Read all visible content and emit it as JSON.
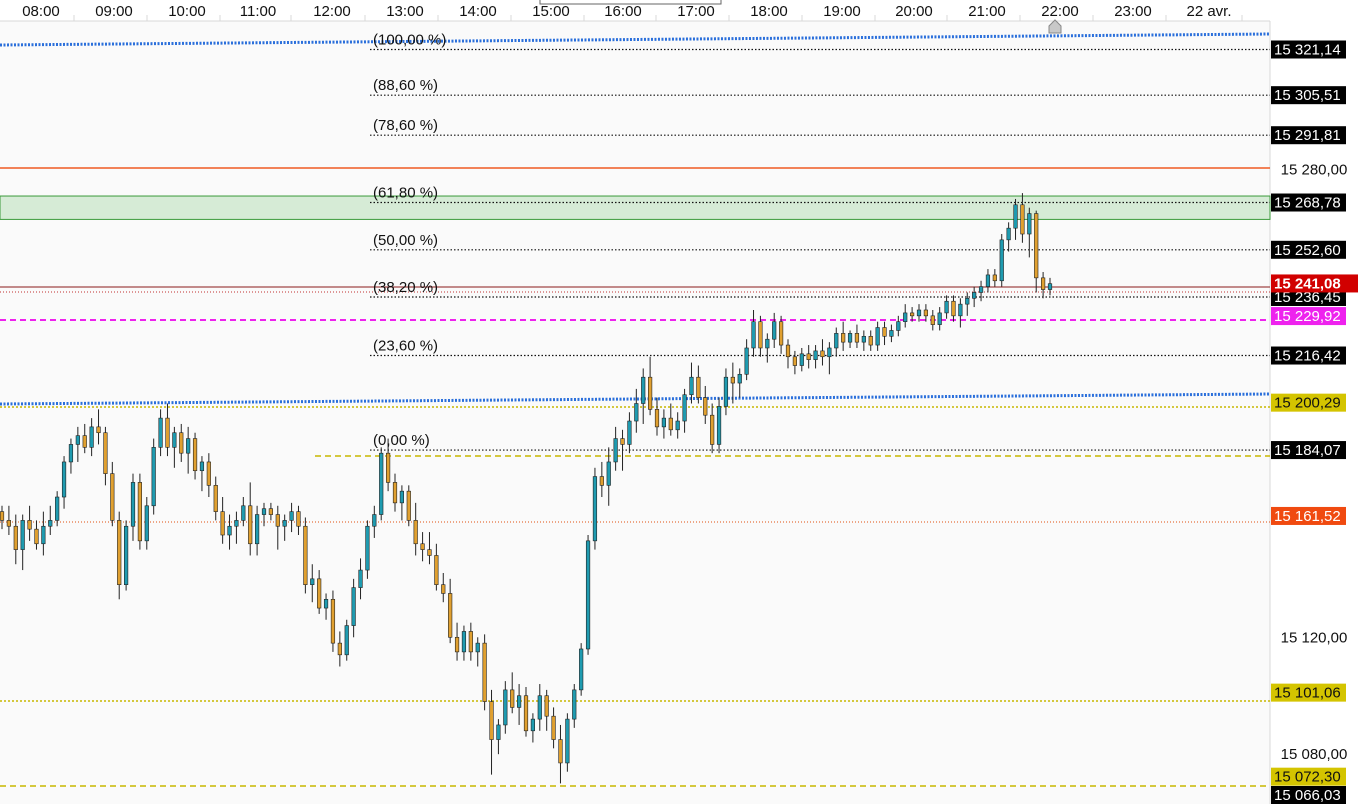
{
  "chart_data": {
    "type": "candlestick",
    "x_axis": {
      "ticks": [
        "08:00",
        "09:00",
        "10:00",
        "11:00",
        "12:00",
        "13:00",
        "14:00",
        "15:00",
        "16:00",
        "17:00",
        "18:00",
        "19:00",
        "20:00",
        "21:00",
        "22:00",
        "23:00",
        "22 avr."
      ]
    },
    "y_axis": {
      "range": [
        15063,
        15333
      ],
      "tick_labels": [
        "15 280,00",
        "15 120,00",
        "15 080,00"
      ],
      "tick_values": [
        15280.0,
        15120.0,
        15080.0
      ]
    },
    "fibonacci": {
      "levels": [
        {
          "label": "(100,00 %)",
          "price": 15321.14,
          "tag": "15 321,14"
        },
        {
          "label": "(88,60 %)",
          "price": 15305.51,
          "tag": "15 305,51"
        },
        {
          "label": "(78,60 %)",
          "price": 15291.81,
          "tag": "15 291,81"
        },
        {
          "label": "(61,80 %)",
          "price": 15268.78,
          "tag": "15 268,78"
        },
        {
          "label": "(50,00 %)",
          "price": 15252.6,
          "tag": "15 252,60"
        },
        {
          "label": "(38,20 %)",
          "price": 15236.45,
          "tag": "15 236,45"
        },
        {
          "label": "(23,60 %)",
          "price": 15216.42,
          "tag": "15 216,42"
        },
        {
          "label": "(0,00 %)",
          "price": 15184.07,
          "tag": "15 184,07"
        }
      ]
    },
    "price_tags": [
      {
        "price": 15241.08,
        "text": "15 241,08",
        "bg": "#d10000",
        "fg": "#ffffff"
      },
      {
        "price": 15229.92,
        "text": "15 229,92",
        "bg": "#ee22ee",
        "fg": "#ffffff"
      },
      {
        "price": 15200.29,
        "text": "15 200,29",
        "bg": "#d4c400",
        "fg": "#111111"
      },
      {
        "price": 15161.52,
        "text": "15 161,52",
        "bg": "#f04a10",
        "fg": "#ffffff"
      },
      {
        "price": 15101.06,
        "text": "15 101,06",
        "bg": "#d4c400",
        "fg": "#111111"
      },
      {
        "price": 15072.3,
        "text": "15 072,30",
        "bg": "#d4c400",
        "fg": "#111111"
      },
      {
        "price": 15066.03,
        "text": "15 066,03",
        "bg": "#000000",
        "fg": "#ffffff"
      }
    ],
    "zone": {
      "from": 15263,
      "to": 15271,
      "color": "#d6ebd6"
    },
    "candles": [
      [
        15163.0,
        15165.0,
        15157.0,
        15160.0
      ],
      [
        15160.0,
        15165.0,
        15155.0,
        15158.0
      ],
      [
        15158.0,
        15162.0,
        15145.0,
        15150.0
      ],
      [
        15150.0,
        15162.0,
        15143.0,
        15160.0
      ],
      [
        15160.0,
        15165.0,
        15153.0,
        15157.0
      ],
      [
        15157.0,
        15160.0,
        15150.0,
        15152.0
      ],
      [
        15152.0,
        15163.0,
        15148.0,
        15158.0
      ],
      [
        15158.0,
        15165.0,
        15155.0,
        15160.0
      ],
      [
        15160.0,
        15170.0,
        15158.0,
        15168.0
      ],
      [
        15168.0,
        15182.0,
        15164.0,
        15180.0
      ],
      [
        15180.0,
        15188.0,
        15176.0,
        15186.0
      ],
      [
        15186.0,
        15192.0,
        15180.0,
        15189.0
      ],
      [
        15189.0,
        15193.0,
        15183.0,
        15185.0
      ],
      [
        15185.0,
        15195.0,
        15182.0,
        15192.0
      ],
      [
        15192.0,
        15198.0,
        15186.0,
        15190.0
      ],
      [
        15190.0,
        15192.0,
        15172.0,
        15176.0
      ],
      [
        15176.0,
        15180.0,
        15158.0,
        15160.0
      ],
      [
        15160.0,
        15163.0,
        15133.0,
        15138.0
      ],
      [
        15138.0,
        15160.0,
        15136.0,
        15158.0
      ],
      [
        15158.0,
        15176.0,
        15153.0,
        15173.0
      ],
      [
        15173.0,
        15176.0,
        15150.0,
        15153.0
      ],
      [
        15153.0,
        15168.0,
        15150.0,
        15165.0
      ],
      [
        15165.0,
        15188.0,
        15162.0,
        15185.0
      ],
      [
        15185.0,
        15198.0,
        15182.0,
        15195.0
      ],
      [
        15195.0,
        15200.0,
        15182.0,
        15185.0
      ],
      [
        15185.0,
        15192.0,
        15178.0,
        15190.0
      ],
      [
        15190.0,
        15193.0,
        15180.0,
        15183.0
      ],
      [
        15183.0,
        15192.0,
        15176.0,
        15188.0
      ],
      [
        15188.0,
        15190.0,
        15174.0,
        15177.0
      ],
      [
        15177.0,
        15182.0,
        15170.0,
        15180.0
      ],
      [
        15180.0,
        15183.0,
        15168.0,
        15172.0
      ],
      [
        15172.0,
        15175.0,
        15160.0,
        15163.0
      ],
      [
        15163.0,
        15168.0,
        15152.0,
        15155.0
      ],
      [
        15155.0,
        15162.0,
        15150.0,
        15158.0
      ],
      [
        15158.0,
        15163.0,
        15152.0,
        15160.0
      ],
      [
        15160.0,
        15168.0,
        15158.0,
        15165.0
      ],
      [
        15165.0,
        15173.0,
        15148.0,
        15152.0
      ],
      [
        15152.0,
        15165.0,
        15148.0,
        15162.0
      ],
      [
        15162.0,
        15166.0,
        15158.0,
        15164.0
      ],
      [
        15164.0,
        15166.0,
        15160.0,
        15162.0
      ],
      [
        15162.0,
        15165.0,
        15150.0,
        15158.0
      ],
      [
        15158.0,
        15162.0,
        15153.0,
        15160.0
      ],
      [
        15160.0,
        15166.0,
        15156.0,
        15163.0
      ],
      [
        15163.0,
        15165.0,
        15155.0,
        15158.0
      ],
      [
        15158.0,
        15161.0,
        15135.0,
        15138.0
      ],
      [
        15138.0,
        15145.0,
        15132.0,
        15140.0
      ],
      [
        15140.0,
        15143.0,
        15128.0,
        15130.0
      ],
      [
        15130.0,
        15135.0,
        15126.0,
        15133.0
      ],
      [
        15133.0,
        15136.0,
        15115.0,
        15118.0
      ],
      [
        15118.0,
        15122.0,
        15110.0,
        15114.0
      ],
      [
        15114.0,
        15126.0,
        15112.0,
        15124.0
      ],
      [
        15124.0,
        15140.0,
        15120.0,
        15137.0
      ],
      [
        15137.0,
        15147.0,
        15133.0,
        15143.0
      ],
      [
        15143.0,
        15160.0,
        15140.0,
        15158.0
      ],
      [
        15158.0,
        15165.0,
        15154.0,
        15162.0
      ],
      [
        15162.0,
        15185.0,
        15160.0,
        15183.0
      ],
      [
        15183.0,
        15188.0,
        15170.0,
        15173.0
      ],
      [
        15173.0,
        15176.0,
        15163.0,
        15166.0
      ],
      [
        15166.0,
        15172.0,
        15160.0,
        15170.0
      ],
      [
        15170.0,
        15172.0,
        15158.0,
        15160.0
      ],
      [
        15160.0,
        15166.0,
        15148.0,
        15152.0
      ],
      [
        15152.0,
        15156.0,
        15146.0,
        15150.0
      ],
      [
        15150.0,
        15156.0,
        15145.0,
        15148.0
      ],
      [
        15148.0,
        15152.0,
        15136.0,
        15138.0
      ],
      [
        15138.0,
        15142.0,
        15132.0,
        15135.0
      ],
      [
        15135.0,
        15140.0,
        15118.0,
        15120.0
      ],
      [
        15120.0,
        15125.0,
        15112.0,
        15115.0
      ],
      [
        15115.0,
        15124.0,
        15112.0,
        15122.0
      ],
      [
        15122.0,
        15125.0,
        15112.0,
        15115.0
      ],
      [
        15115.0,
        15120.0,
        15110.0,
        15118.0
      ],
      [
        15118.0,
        15121.0,
        15095.0,
        15098.0
      ],
      [
        15098.0,
        15102.0,
        15073.0,
        15085.0
      ],
      [
        15085.0,
        15092.0,
        15080.0,
        15090.0
      ],
      [
        15090.0,
        15105.0,
        15087.0,
        15102.0
      ],
      [
        15102.0,
        15108.0,
        15094.0,
        15096.0
      ],
      [
        15096.0,
        15104.0,
        15090.0,
        15100.0
      ],
      [
        15100.0,
        15103.0,
        15086.0,
        15088.0
      ],
      [
        15088.0,
        15094.0,
        15084.0,
        15092.0
      ],
      [
        15092.0,
        15104.0,
        15088.0,
        15100.0
      ],
      [
        15100.0,
        15102.0,
        15088.0,
        15093.0
      ],
      [
        15093.0,
        15096.0,
        15082.0,
        15085.0
      ],
      [
        15085.0,
        15090.0,
        15070.0,
        15077.0
      ],
      [
        15077.0,
        15094.0,
        15074.0,
        15092.0
      ],
      [
        15092.0,
        15104.0,
        15089.0,
        15102.0
      ],
      [
        15102.0,
        15118.0,
        15100.0,
        15116.0
      ],
      [
        15116.0,
        15155.0,
        15114.0,
        15153.0
      ],
      [
        15153.0,
        15178.0,
        15150.0,
        15175.0
      ],
      [
        15175.0,
        15180.0,
        15168.0,
        15172.0
      ],
      [
        15172.0,
        15185.0,
        15165.0,
        15180.0
      ],
      [
        15180.0,
        15192.0,
        15177.0,
        15188.0
      ],
      [
        15188.0,
        15191.0,
        15177.0,
        15186.0
      ],
      [
        15186.0,
        15197.0,
        15183.0,
        15194.0
      ],
      [
        15194.0,
        15205.0,
        15190.0,
        15200.0
      ],
      [
        15200.0,
        15212.0,
        15193.0,
        15209.0
      ],
      [
        15209.0,
        15216.0,
        15196.0,
        15198.0
      ],
      [
        15198.0,
        15202.0,
        15189.0,
        15192.0
      ],
      [
        15192.0,
        15198.0,
        15188.0,
        15195.0
      ],
      [
        15195.0,
        15200.0,
        15189.0,
        15191.0
      ],
      [
        15191.0,
        15197.0,
        15188.0,
        15194.0
      ],
      [
        15194.0,
        15205.0,
        15190.0,
        15203.0
      ],
      [
        15203.0,
        15214.0,
        15200.0,
        15209.0
      ],
      [
        15209.0,
        15213.0,
        15200.0,
        15202.0
      ],
      [
        15202.0,
        15206.0,
        15193.0,
        15196.0
      ],
      [
        15196.0,
        15200.0,
        15183.0,
        15186.0
      ],
      [
        15186.0,
        15202.0,
        15183.0,
        15199.0
      ],
      [
        15199.0,
        15212.0,
        15196.0,
        15209.0
      ],
      [
        15209.0,
        15214.0,
        15200.0,
        15207.0
      ],
      [
        15207.0,
        15212.0,
        15202.0,
        15210.0
      ],
      [
        15210.0,
        15222.0,
        15208.0,
        15219.0
      ],
      [
        15219.0,
        15232.0,
        15216.0,
        15228.0
      ],
      [
        15228.0,
        15230.0,
        15216.0,
        15219.0
      ],
      [
        15219.0,
        15224.0,
        15214.0,
        15222.0
      ],
      [
        15222.0,
        15231.0,
        15219.0,
        15228.0
      ],
      [
        15228.0,
        15230.0,
        15217.0,
        15220.0
      ],
      [
        15220.0,
        15222.0,
        15212.0,
        15216.0
      ],
      [
        15216.0,
        15218.0,
        15210.0,
        15213.0
      ],
      [
        15213.0,
        15219.0,
        15211.0,
        15217.0
      ],
      [
        15217.0,
        15220.0,
        15212.0,
        15215.0
      ],
      [
        15215.0,
        15220.0,
        15212.0,
        15218.0
      ],
      [
        15218.0,
        15222.0,
        15213.0,
        15216.0
      ],
      [
        15216.0,
        15221.0,
        15210.0,
        15219.0
      ],
      [
        15219.0,
        15226.0,
        15216.0,
        15224.0
      ],
      [
        15224.0,
        15228.0,
        15218.0,
        15221.0
      ],
      [
        15221.0,
        15225.0,
        15219.0,
        15224.0
      ],
      [
        15224.0,
        15227.0,
        15219.0,
        15221.0
      ],
      [
        15221.0,
        15225.0,
        15218.0,
        15223.0
      ],
      [
        15223.0,
        15225.0,
        15218.0,
        15220.0
      ],
      [
        15220.0,
        15228.0,
        15218.0,
        15226.0
      ],
      [
        15226.0,
        15228.0,
        15220.0,
        15223.0
      ],
      [
        15223.0,
        15227.0,
        15221.0,
        15225.0
      ],
      [
        15225.0,
        15230.0,
        15223.0,
        15228.0
      ],
      [
        15228.0,
        15234.0,
        15226.0,
        15231.0
      ],
      [
        15231.0,
        15233.0,
        15228.0,
        15230.0
      ],
      [
        15230.0,
        15234.0,
        15228.0,
        15232.0
      ],
      [
        15232.0,
        15234.0,
        15228.0,
        15230.0
      ],
      [
        15230.0,
        15232.0,
        15225.0,
        15227.0
      ],
      [
        15227.0,
        15233.0,
        15225.0,
        15231.0
      ],
      [
        15231.0,
        15237.0,
        15229.0,
        15235.0
      ],
      [
        15235.0,
        15237.0,
        15228.0,
        15230.0
      ],
      [
        15230.0,
        15236.0,
        15226.0,
        15234.0
      ],
      [
        15234.0,
        15238.0,
        15230.0,
        15236.0
      ],
      [
        15236.0,
        15240.0,
        15233.0,
        15238.0
      ],
      [
        15238.0,
        15242.0,
        15235.0,
        15240.0
      ],
      [
        15240.0,
        15246.0,
        15238.0,
        15244.0
      ],
      [
        15244.0,
        15246.0,
        15240.0,
        15242.0
      ],
      [
        15242.0,
        15258.0,
        15240.0,
        15256.0
      ],
      [
        15256.0,
        15262.0,
        15252.0,
        15260.0
      ],
      [
        15260.0,
        15270.0,
        15256.0,
        15268.0
      ],
      [
        15268.0,
        15272.0,
        15255.0,
        15258.0
      ],
      [
        15258.0,
        15267.0,
        15250.0,
        15265.0
      ],
      [
        15265.0,
        15266.0,
        15238.0,
        15243.0
      ],
      [
        15243.0,
        15245.0,
        15236.0,
        15239.0
      ],
      [
        15239.0,
        15243.0,
        15237.0,
        15241.0
      ]
    ]
  }
}
